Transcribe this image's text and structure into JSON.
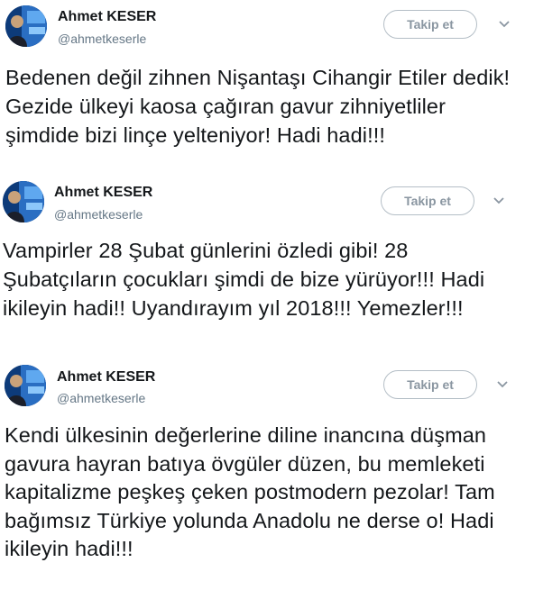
{
  "tweets": [
    {
      "name": "Ahmet KESER",
      "handle": "@ahmetkeserle",
      "follow_label": "Takip et",
      "text": "Bedenen değil zihnen Nişantaşı Cihangir Etiler dedik! Gezide ülkeyi kaosa çağıran gavur zihniyetliler şimdide bizi linçe yelteniyor! Hadi hadi!!!"
    },
    {
      "name": "Ahmet KESER",
      "handle": "@ahmetkeserle",
      "follow_label": "Takip et",
      "text": "Vampirler 28 Şubat günlerini özledi gibi! 28 Şubatçıların çocukları şimdi de bize yürüyor!!! Hadi ikileyin hadi!! Uyandırayım yıl 2018!!! Yemezler!!!"
    },
    {
      "name": "Ahmet KESER",
      "handle": "@ahmetkeserle",
      "follow_label": "Takip et",
      "text": "Kendi ülkesinin değerlerine diline inancına düşman gavura hayran batıya övgüler düzen, bu memleketi kapitalizme peşkeş çeken postmodern pezolar! Tam bağımsız Türkiye yolunda Anadolu ne derse o! Hadi ikileyin hadi!!!"
    }
  ],
  "colors": {
    "name": "#14171a",
    "handle": "#657786",
    "follow_border": "#b4bec6",
    "follow_text": "#8a96a1",
    "avatar_bg": "#0d3b7a"
  },
  "icons": {
    "avatar": "profile-photo",
    "caret": "chevron-down-icon"
  }
}
